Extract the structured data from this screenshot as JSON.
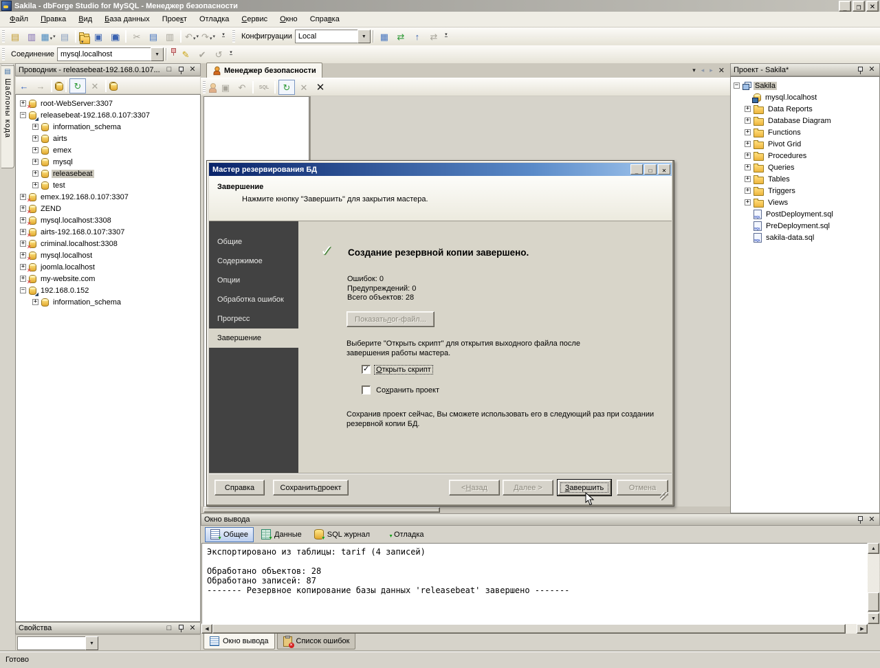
{
  "window": {
    "title": "Sakila - dbForge Studio for MySQL - Менеджер безопасности"
  },
  "menu": [
    {
      "label": "Файл",
      "u": 0
    },
    {
      "label": "Правка",
      "u": 0
    },
    {
      "label": "Вид",
      "u": 0
    },
    {
      "label": "База данных",
      "u": 0
    },
    {
      "label": "Проект",
      "u": 4
    },
    {
      "label": "Отладка",
      "u": 4
    },
    {
      "label": "Сервис",
      "u": 0
    },
    {
      "label": "Окно",
      "u": 0
    },
    {
      "label": "Справка",
      "u": 4
    }
  ],
  "toolbar_main": [
    {
      "name": "new-sql-icon",
      "glyph": "▤",
      "cls": "ic g-sql"
    },
    {
      "name": "new-sql-connection-icon",
      "glyph": "▥",
      "cls": "ic g-db"
    },
    {
      "name": "new-object-icon",
      "glyph": "▦",
      "cls": "ic g-multi arrow"
    },
    {
      "name": "new-document-icon",
      "glyph": "▤",
      "cls": "ic g-new"
    },
    {
      "cls": "tsep"
    },
    {
      "name": "open-file-icon",
      "glyph": "",
      "cls": "fold arrow"
    },
    {
      "name": "save-icon",
      "glyph": "▣",
      "cls": "ic g-save"
    },
    {
      "name": "save-all-icon",
      "glyph": "▣",
      "cls": "ic g-save dbl"
    },
    {
      "cls": "tsep"
    },
    {
      "name": "cut-icon",
      "glyph": "✂",
      "cls": "ic dis"
    },
    {
      "name": "copy-icon",
      "glyph": "▤",
      "cls": "ic g-copy"
    },
    {
      "name": "paste-icon",
      "glyph": "▥",
      "cls": "ic dis"
    },
    {
      "cls": "tsep"
    },
    {
      "name": "undo-icon",
      "glyph": "↶",
      "cls": "ic dis arrow"
    },
    {
      "name": "redo-icon",
      "glyph": "↷",
      "cls": "ic dis arrow"
    }
  ],
  "toolbar_config": {
    "label": "Конфигруации",
    "value": "Local",
    "icons": [
      {
        "name": "data-grid-icon",
        "glyph": "▦",
        "cls": "ic g-grid"
      },
      {
        "name": "schema-sync-icon",
        "glyph": "⇄",
        "cls": "ic g-sync"
      },
      {
        "name": "upload-schema-icon",
        "glyph": "↑",
        "cls": "ic g-up"
      },
      {
        "name": "sync-disabled-icon",
        "glyph": "⇄",
        "cls": "ic dis"
      }
    ]
  },
  "connection_bar": {
    "label": "Соединение",
    "value": "mysql.localhost",
    "icons": [
      {
        "name": "pin-connection-icon",
        "glyph": "",
        "cls": "pinred"
      },
      {
        "name": "edit-connection-icon",
        "glyph": "✎",
        "cls": "ic g-pencil"
      },
      {
        "name": "check-connection-icon",
        "glyph": "✔",
        "cls": "ic dis"
      },
      {
        "name": "reconnect-icon",
        "glyph": "↺",
        "cls": "ic dis"
      }
    ]
  },
  "code_templates_tab": {
    "label": "Шаблоны кода"
  },
  "explorer": {
    "title": "Проводник - releasebeat-192.168.0.107...",
    "toolbar": [
      {
        "name": "back-icon",
        "glyph": "←",
        "cls": "ic g-back"
      },
      {
        "name": "forward-icon",
        "glyph": "→",
        "cls": "ic dis"
      },
      {
        "cls": "tsep"
      },
      {
        "name": "new-connection-icon",
        "glyph": "",
        "cls": "cyl"
      },
      {
        "cls": "tsep"
      },
      {
        "name": "refresh-icon",
        "glyph": "↻",
        "cls": "ic g-refresh",
        "boxed": "boxed"
      },
      {
        "name": "delete-icon",
        "glyph": "✕",
        "cls": "ic dis"
      },
      {
        "cls": "tsep"
      },
      {
        "name": "show-databases-icon",
        "glyph": "",
        "cls": "cyl",
        "boxed": "boxed-on"
      }
    ],
    "tree": [
      {
        "label": "root-WebServer:3307",
        "cls": "lvl0",
        "exp": "+",
        "icon": "cyl cyl-x"
      },
      {
        "label": "releasebeat-192.168.0.107:3307",
        "cls": "lvl0",
        "exp": "−",
        "icon": "cyl cyl-on"
      },
      {
        "label": "information_schema",
        "cls": "lvl1",
        "exp": "+",
        "icon": "cyl"
      },
      {
        "label": "airts",
        "cls": "lvl1",
        "exp": "+",
        "icon": "cyl"
      },
      {
        "label": "emex",
        "cls": "lvl1",
        "exp": "+",
        "icon": "cyl"
      },
      {
        "label": "mysql",
        "cls": "lvl1",
        "exp": "+",
        "icon": "cyl"
      },
      {
        "label": "releasebeat",
        "cls": "lvl1 selected",
        "exp": "+",
        "icon": "cyl"
      },
      {
        "label": "test",
        "cls": "lvl1",
        "exp": "+",
        "icon": "cyl"
      },
      {
        "label": "emex.192.168.0.107:3307",
        "cls": "lvl0",
        "exp": "+",
        "icon": "cyl cyl-x"
      },
      {
        "label": "ZEND",
        "cls": "lvl0",
        "exp": "+",
        "icon": "cyl cyl-x"
      },
      {
        "label": "mysql.localhost:3308",
        "cls": "lvl0",
        "exp": "+",
        "icon": "cyl cyl-x"
      },
      {
        "label": "airts-192.168.0.107:3307",
        "cls": "lvl0",
        "exp": "+",
        "icon": "cyl cyl-x"
      },
      {
        "label": "criminal.localhost:3308",
        "cls": "lvl0",
        "exp": "+",
        "icon": "cyl cyl-x"
      },
      {
        "label": "mysql.localhost",
        "cls": "lvl0",
        "exp": "+",
        "icon": "cyl cyl-x"
      },
      {
        "label": "joomla.localhost",
        "cls": "lvl0",
        "exp": "+",
        "icon": "cyl cyl-x"
      },
      {
        "label": "my-website.com",
        "cls": "lvl0",
        "exp": "+",
        "icon": "cyl cyl-x"
      },
      {
        "label": "192.168.0.152",
        "cls": "lvl0",
        "exp": "−",
        "icon": "cyl cyl-on"
      },
      {
        "label": "information_schema",
        "cls": "lvl1",
        "exp": "+",
        "icon": "cyl"
      }
    ]
  },
  "properties_panel": {
    "title": "Свойства"
  },
  "document": {
    "tab": "Менеджер безопасности"
  },
  "doc_toolbar": [
    {
      "name": "new-user-icon",
      "glyph": "",
      "cls": "person dis2"
    },
    {
      "name": "save-icon",
      "glyph": "▣",
      "cls": "ic dis"
    },
    {
      "name": "undo-icon",
      "glyph": "↶",
      "cls": "ic dis"
    },
    {
      "cls": "tsep"
    },
    {
      "name": "sql-icon",
      "glyph": "SQL",
      "cls": "ic sqltxt dis"
    },
    {
      "cls": "tsep"
    },
    {
      "name": "refresh-icon",
      "glyph": "↻",
      "cls": "ic g-refresh",
      "boxed": "boxed"
    },
    {
      "name": "cancel-icon",
      "glyph": "✕",
      "cls": "ic dis"
    },
    {
      "name": "close-manager-icon",
      "glyph": "✕",
      "cls": "ic bigx"
    }
  ],
  "project": {
    "title": "Проект - Sakila*",
    "tree": [
      {
        "label": "Sakila",
        "cls": "plvl0 selected",
        "exp": "−",
        "icon": "proj"
      },
      {
        "label": "mysql.localhost",
        "cls": "plvl1",
        "exp": "",
        "icon": "cyl cyl-srv"
      },
      {
        "label": "Data Reports",
        "cls": "plvl1",
        "exp": "+",
        "icon": "fold"
      },
      {
        "label": "Database Diagram",
        "cls": "plvl1",
        "exp": "+",
        "icon": "fold"
      },
      {
        "label": "Functions",
        "cls": "plvl1",
        "exp": "+",
        "icon": "fold"
      },
      {
        "label": "Pivot Grid",
        "cls": "plvl1",
        "exp": "+",
        "icon": "fold"
      },
      {
        "label": "Procedures",
        "cls": "plvl1",
        "exp": "+",
        "icon": "fold"
      },
      {
        "label": "Queries",
        "cls": "plvl1",
        "exp": "+",
        "icon": "fold"
      },
      {
        "label": "Tables",
        "cls": "plvl1",
        "exp": "+",
        "icon": "fold"
      },
      {
        "label": "Triggers",
        "cls": "plvl1",
        "exp": "+",
        "icon": "fold"
      },
      {
        "label": "Views",
        "cls": "plvl1",
        "exp": "+",
        "icon": "fold"
      },
      {
        "label": "PostDeployment.sql",
        "cls": "plvl1",
        "exp": "",
        "icon": "sqldoc"
      },
      {
        "label": "PreDeployment.sql",
        "cls": "plvl1",
        "exp": "",
        "icon": "sqldoc"
      },
      {
        "label": "sakila-data.sql",
        "cls": "plvl1",
        "exp": "",
        "icon": "sqldoc"
      }
    ]
  },
  "wizard": {
    "title": "Мастер резервирования БД",
    "header": {
      "title": "Завершение",
      "subtitle": "Нажмите кнопку \"Завершить\" для закрытия мастера."
    },
    "steps": [
      {
        "label": "Общие"
      },
      {
        "label": "Содержимое"
      },
      {
        "label": "Опции"
      },
      {
        "label": "Обработка ошибок"
      },
      {
        "label": "Прогресс"
      },
      {
        "label": "Завершение",
        "cls": "active"
      }
    ],
    "result_title": "Создание резервной копии завершено.",
    "stats": [
      {
        "label": "Ошибок: 0"
      },
      {
        "label": "Предупреждений: 0"
      },
      {
        "label": "Всего объектов: 28"
      }
    ],
    "log_button": {
      "label": "Показать лог-файл...",
      "u": 9
    },
    "hint_open": "Выберите \"Открыть скрипт\" для открытия выходного файла после завершения работы мастера.",
    "checkbox_open": {
      "label": "Открыть скрипт",
      "u": 0,
      "checked": true
    },
    "checkbox_save": {
      "label": "Сохранить проект",
      "u": 2,
      "checked": false
    },
    "hint_save": "Сохранив проект сейчас, Вы сможете использовать его в следующий раз при создании резервной копии БД.",
    "buttons": {
      "help": {
        "label": "Справка"
      },
      "save_project": {
        "label": "Сохранить проект",
        "u": 10
      },
      "back": {
        "label": "< Назад",
        "u": 2
      },
      "next": {
        "label": "Далее >",
        "u": 0
      },
      "finish": {
        "label": "Завершить",
        "u": 0
      },
      "cancel": {
        "label": "Отмена"
      }
    }
  },
  "output": {
    "title": "Окно вывода",
    "tabs": [
      {
        "label": "Общее",
        "cls": "active",
        "icon": "oti-doc",
        "name": "output-tab-general"
      },
      {
        "label": "Данные",
        "icon": "oti-table",
        "name": "output-tab-data"
      },
      {
        "label": "SQL журнал",
        "icon": "oti-db",
        "name": "output-tab-sql-log"
      },
      {
        "label": "Отладка",
        "icon": "oti-gear",
        "name": "output-tab-debug"
      }
    ],
    "lines": [
      {
        "label": "Экспортировано из таблицы: tarif (4 записей)"
      },
      {
        "label": " "
      },
      {
        "label": "Обработано объектов: 28"
      },
      {
        "label": "Обработано записей: 87"
      },
      {
        "label": "------- Резервное копирование базы данных 'releasebeat' завершено -------"
      }
    ]
  },
  "bottom_tabs": [
    {
      "label": "Окно вывода",
      "cls": "active",
      "icon": "bt-doc",
      "name": "dock-tab-output"
    },
    {
      "label": "Список ошибок",
      "icon": "bt-err",
      "name": "dock-tab-error-list"
    }
  ],
  "status_bar": {
    "text": "Готово"
  }
}
